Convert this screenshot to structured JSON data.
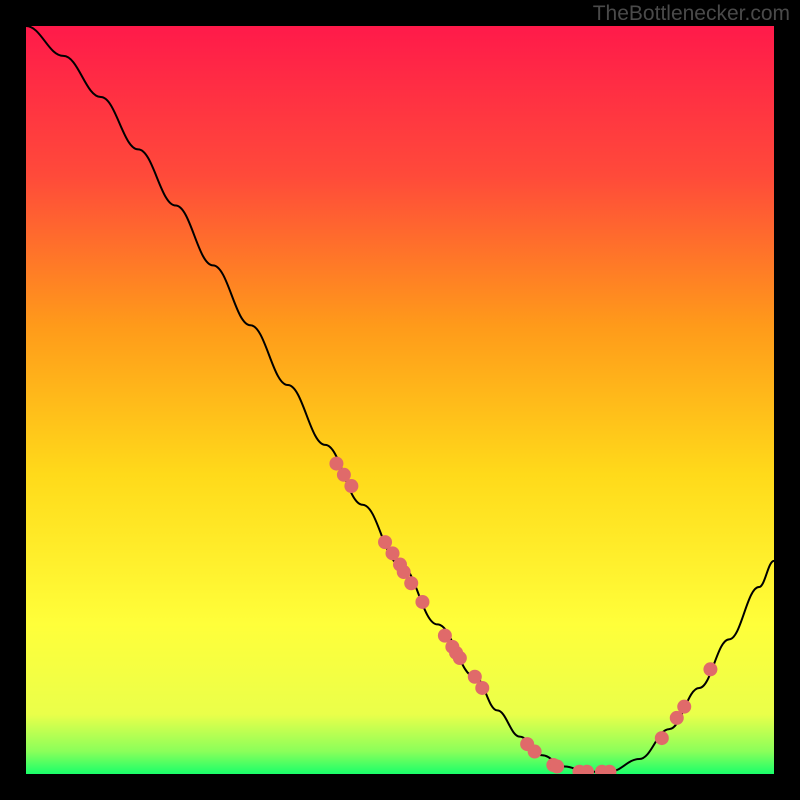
{
  "watermark": "TheBottlenecker.com",
  "chart_data": {
    "type": "line",
    "title": "",
    "xlabel": "",
    "ylabel": "",
    "xlim": [
      0,
      100
    ],
    "ylim": [
      0,
      100
    ],
    "series": [
      {
        "name": "curve",
        "x": [
          0,
          5,
          10,
          15,
          20,
          25,
          30,
          35,
          40,
          45,
          50,
          55,
          60,
          63,
          66,
          69,
          72,
          75,
          78,
          82,
          86,
          90,
          94,
          98,
          100
        ],
        "y": [
          100,
          96,
          90.5,
          83.5,
          76,
          68,
          60,
          52,
          44,
          36,
          28,
          20,
          13,
          8.5,
          5,
          2.5,
          1,
          0.3,
          0.3,
          2,
          6,
          11.5,
          18,
          25,
          28.5
        ]
      }
    ],
    "markers": [
      {
        "x": 41.5,
        "y": 41.5
      },
      {
        "x": 42.5,
        "y": 40
      },
      {
        "x": 43.5,
        "y": 38.5
      },
      {
        "x": 48,
        "y": 31
      },
      {
        "x": 49,
        "y": 29.5
      },
      {
        "x": 50,
        "y": 28
      },
      {
        "x": 50.5,
        "y": 27
      },
      {
        "x": 51.5,
        "y": 25.5
      },
      {
        "x": 53,
        "y": 23
      },
      {
        "x": 56,
        "y": 18.5
      },
      {
        "x": 57,
        "y": 17
      },
      {
        "x": 57.5,
        "y": 16.2
      },
      {
        "x": 58,
        "y": 15.5
      },
      {
        "x": 60,
        "y": 13
      },
      {
        "x": 61,
        "y": 11.5
      },
      {
        "x": 67,
        "y": 4
      },
      {
        "x": 68,
        "y": 3
      },
      {
        "x": 70.5,
        "y": 1.2
      },
      {
        "x": 71,
        "y": 1
      },
      {
        "x": 74,
        "y": 0.3
      },
      {
        "x": 75,
        "y": 0.3
      },
      {
        "x": 77,
        "y": 0.3
      },
      {
        "x": 78,
        "y": 0.3
      },
      {
        "x": 85,
        "y": 4.8
      },
      {
        "x": 87,
        "y": 7.5
      },
      {
        "x": 88,
        "y": 9
      },
      {
        "x": 91.5,
        "y": 14
      }
    ],
    "gradient_stops": [
      {
        "offset": 0,
        "color": "#ff1a4a"
      },
      {
        "offset": 20,
        "color": "#ff4a3a"
      },
      {
        "offset": 40,
        "color": "#ff9a1a"
      },
      {
        "offset": 60,
        "color": "#ffda1a"
      },
      {
        "offset": 80,
        "color": "#ffff3a"
      },
      {
        "offset": 92,
        "color": "#eaff4a"
      },
      {
        "offset": 97,
        "color": "#8aff5a"
      },
      {
        "offset": 100,
        "color": "#1aff6a"
      }
    ],
    "marker_color": "#e06a6a",
    "curve_color": "#000000"
  }
}
